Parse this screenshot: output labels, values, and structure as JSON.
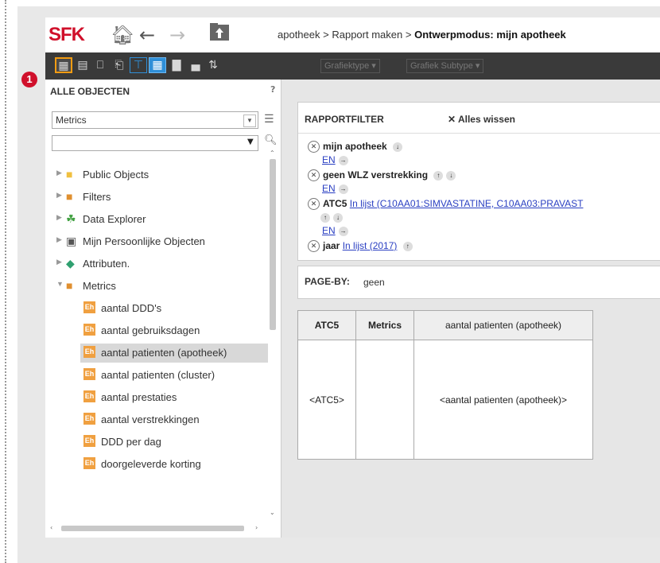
{
  "header": {
    "logo": "SFK",
    "breadcrumb_parts": [
      "apotheek",
      "Rapport maken",
      "Ontwerpmodus: mijn apotheek"
    ],
    "separator": ">"
  },
  "toolbar": {
    "chart_type_label": "Grafiektype",
    "chart_subtype_label": "Grafiek Subtype",
    "badge": "1"
  },
  "left_panel": {
    "title": "ALLE OBJECTEN",
    "help": "?",
    "selected_type": "Metrics",
    "search_value": "",
    "tree": [
      {
        "label": "Public Objects",
        "icon": "folder-icon",
        "expanded": false
      },
      {
        "label": "Filters",
        "icon": "filter-icon",
        "expanded": false
      },
      {
        "label": "Data Explorer",
        "icon": "hierarchy-icon",
        "expanded": false
      },
      {
        "label": "Mijn Persoonlijke Objecten",
        "icon": "personal-folder-icon",
        "expanded": false
      },
      {
        "label": "Attributen.",
        "icon": "attribute-icon",
        "expanded": false
      },
      {
        "label": "Metrics",
        "icon": "metrics-folder-icon",
        "expanded": true
      }
    ],
    "metrics": [
      {
        "label": "aantal DDD's",
        "selected": false
      },
      {
        "label": "aantal gebruiksdagen",
        "selected": false
      },
      {
        "label": "aantal patienten (apotheek)",
        "selected": true
      },
      {
        "label": "aantal patienten (cluster)",
        "selected": false
      },
      {
        "label": "aantal prestaties",
        "selected": false
      },
      {
        "label": "aantal verstrekkingen",
        "selected": false
      },
      {
        "label": "DDD per dag",
        "selected": false
      },
      {
        "label": "doorgeleverde korting",
        "selected": false
      }
    ]
  },
  "report_filter": {
    "title": "RAPPORTFILTER",
    "clear_all": "Alles wissen",
    "and_label": "EN",
    "conditions": [
      {
        "name": "mijn apotheek",
        "link": ""
      },
      {
        "name": "geen WLZ verstrekking",
        "link": ""
      },
      {
        "name": "ATC5",
        "link": "In lijst  (C10AA01:SIMVASTATINE, C10AA03:PRAVAST"
      },
      {
        "name": "jaar",
        "link": "In lijst  (2017)"
      }
    ]
  },
  "page_by": {
    "label": "PAGE-BY:",
    "value": "geen"
  },
  "grid": {
    "headers": [
      "ATC5",
      "Metrics",
      "aantal patienten (apotheek)"
    ],
    "row": [
      "<ATC5>",
      "",
      "<aantal patienten (apotheek)>"
    ]
  }
}
